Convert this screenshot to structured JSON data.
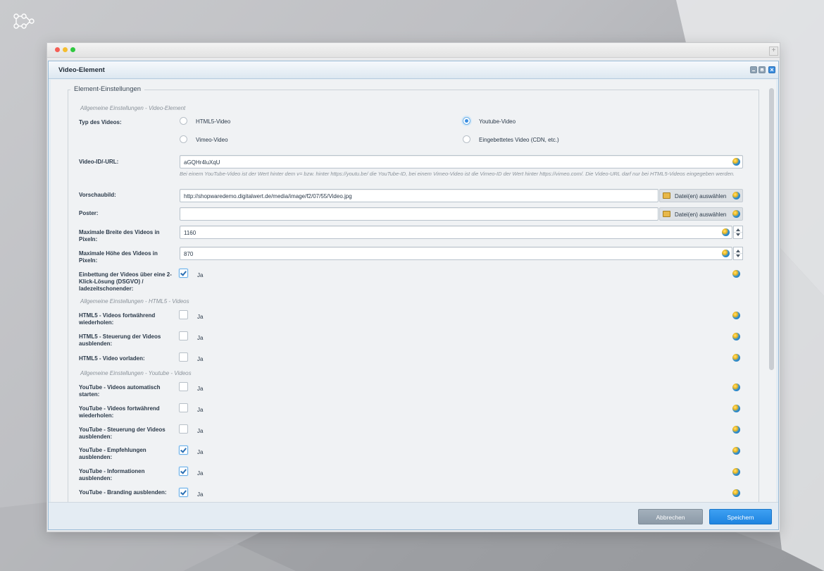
{
  "colors": {
    "accent": "#1e84e0",
    "cancel": "#8c9aa7"
  },
  "dialog": {
    "title": "Video-Element",
    "fieldset_legend": "Element-Einstellungen"
  },
  "sections": {
    "general": "Allgemeine Einstellungen - Video-Element",
    "html5": "Allgemeine Einstellungen - HTML5 - Videos",
    "youtube": "Allgemeine Einstellungen - Youtube - Videos"
  },
  "type": {
    "label": "Typ des Videos:",
    "options": {
      "html5": "HTML5-Video",
      "youtube": "Youtube-Video",
      "vimeo": "Vimeo-Video",
      "embedded": "Eingebettetes Video (CDN, etc.)"
    },
    "selected": "Youtube-Video"
  },
  "fields": {
    "video_id": {
      "label": "Video-ID/-URL:",
      "value": "aGQHr4luXqU"
    },
    "hint": "Bei einem YouTube-Video ist der Wert hinter dem v= bzw. hinter https://youtu.be/ die YouTube-ID, bei einem Vimeo-Video ist die Vimeo-ID der Wert hinter https://vimeo.com/. Die Video-URL darf nur bei HTML5-Videos eingegeben werden.",
    "preview": {
      "label": "Vorschaubild:",
      "value": "http://shopwaredemo.digitalwert.de/media/image/f2/07/55/Video.jpg"
    },
    "poster": {
      "label": "Poster:",
      "value": ""
    },
    "max_width": {
      "label": "Maximale Breite des Videos in Pixeln:",
      "value": "1160"
    },
    "max_height": {
      "label": "Maximale Höhe des Videos in Pixeln:",
      "value": "870"
    },
    "file_button": "Datei(en) auswählen"
  },
  "checkbox_text": "Ja",
  "options": {
    "gdpr": {
      "label": "Einbettung der Videos über eine 2-Klick-Lösung (DSGVO) / ladezeitschonender:",
      "checked": true
    },
    "html5_loop": {
      "label": "HTML5 - Videos fortwährend wiederholen:",
      "checked": false
    },
    "html5_controls": {
      "label": "HTML5 - Steuerung der Videos ausblenden:",
      "checked": false
    },
    "html5_preload": {
      "label": "HTML5 - Video vorladen:",
      "checked": false
    },
    "yt_autoplay": {
      "label": "YouTube - Videos automatisch starten:",
      "checked": false
    },
    "yt_loop": {
      "label": "YouTube - Videos fortwährend wiederholen:",
      "checked": false
    },
    "yt_controls": {
      "label": "YouTube - Steuerung der Videos ausblenden:",
      "checked": false
    },
    "yt_recommend": {
      "label": "YouTube - Empfehlungen ausblenden:",
      "checked": true
    },
    "yt_info": {
      "label": "YouTube - Informationen ausblenden:",
      "checked": true
    },
    "yt_branding": {
      "label": "YouTube - Branding ausblenden:",
      "checked": true
    }
  },
  "footer": {
    "cancel": "Abbrechen",
    "save": "Speichern"
  }
}
